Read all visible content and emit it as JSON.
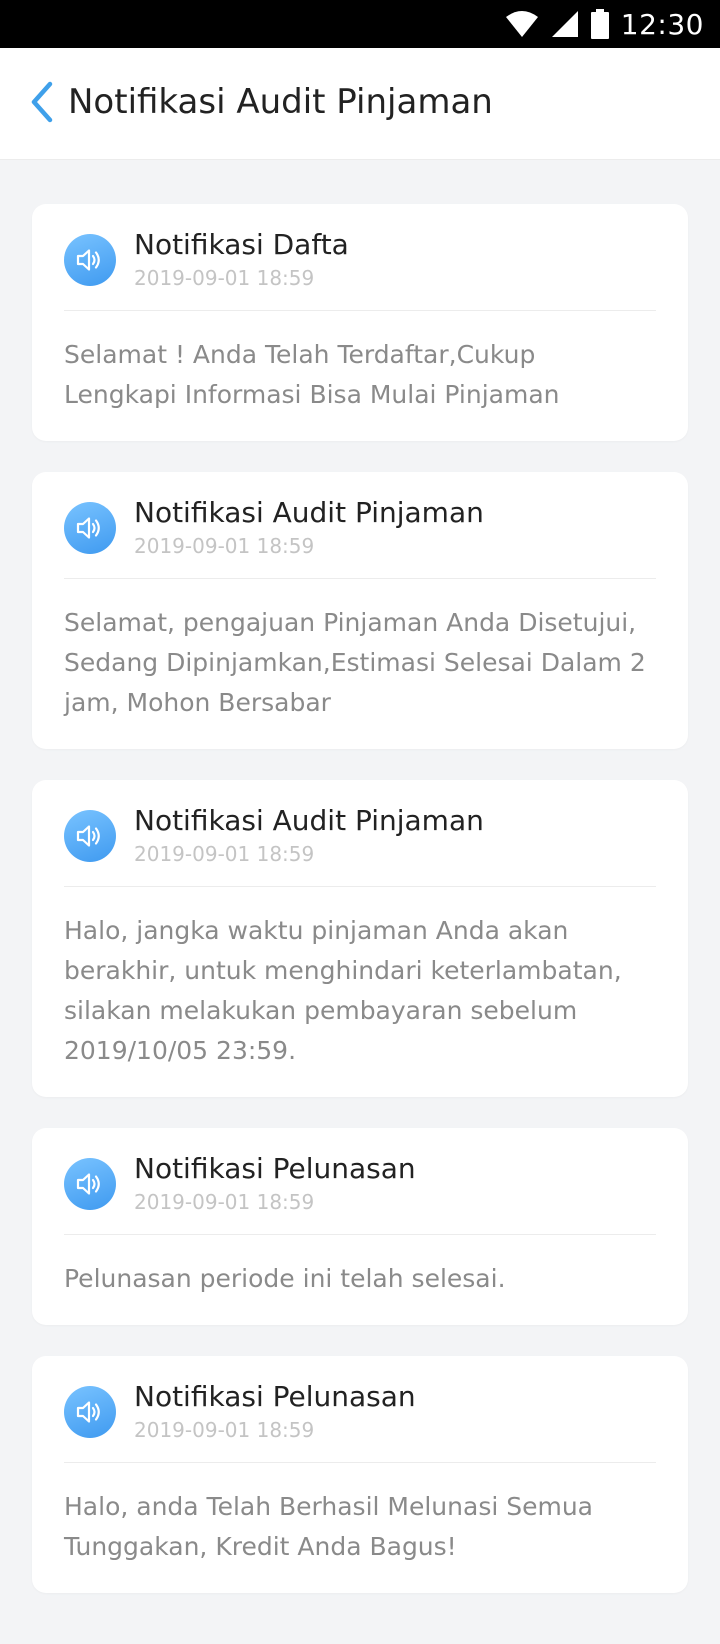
{
  "status_bar": {
    "time": "12:30",
    "icons": [
      "wifi-icon",
      "signal-icon",
      "battery-icon"
    ]
  },
  "header": {
    "back_icon": "chevron-left-icon",
    "title": "Notifikasi Audit Pinjaman"
  },
  "colors": {
    "accent": "#3fa0ea",
    "icon_gradient_start": "#79c3ff",
    "icon_gradient_end": "#3f9af0",
    "page_background": "#f3f4f6"
  },
  "notifications": [
    {
      "icon": "speaker-icon",
      "title": "Notifikasi Dafta",
      "time": "2019-09-01 18:59",
      "message": "Selamat ! Anda Telah Terdaftar,Cukup Lengkapi Informasi Bisa Mulai Pinjaman"
    },
    {
      "icon": "speaker-icon",
      "title": "Notifikasi Audit Pinjaman",
      "time": "2019-09-01 18:59",
      "message": "Selamat, pengajuan Pinjaman Anda Disetujui, Sedang Dipinjamkan,Estimasi Selesai Dalam 2 jam, Mohon Bersabar"
    },
    {
      "icon": "speaker-icon",
      "title": "Notifikasi Audit Pinjaman",
      "time": "2019-09-01 18:59",
      "message": "Halo, jangka waktu pinjaman Anda akan berakhir, untuk menghindari keterlambatan, silakan melakukan pembayaran sebelum 2019/10/05 23:59."
    },
    {
      "icon": "speaker-icon",
      "title": "Notifikasi Pelunasan",
      "time": "2019-09-01 18:59",
      "message": "Pelunasan periode ini telah selesai."
    },
    {
      "icon": "speaker-icon",
      "title": "Notifikasi Pelunasan",
      "time": "2019-09-01 18:59",
      "message": "Halo, anda Telah Berhasil Melunasi Semua Tunggakan, Kredit Anda Bagus!"
    }
  ]
}
